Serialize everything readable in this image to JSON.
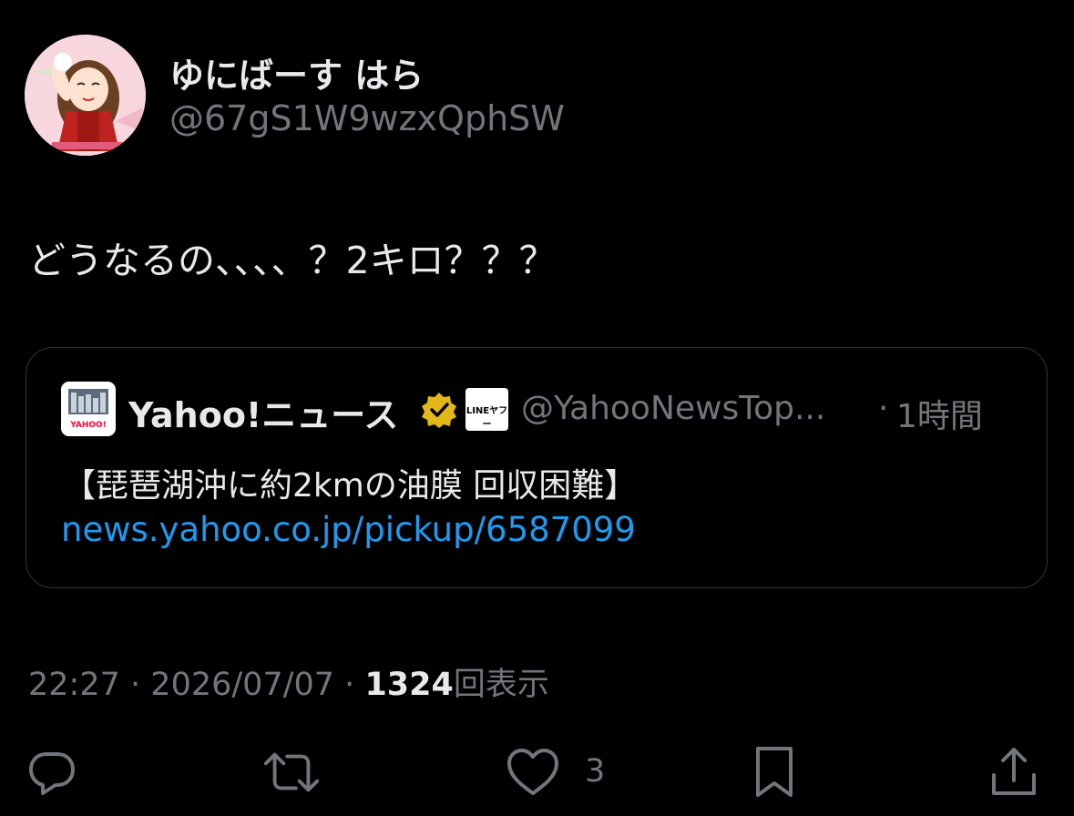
{
  "author": {
    "display_name": "ゆにばーす はら",
    "handle": "@67gS1W9wzxQphSW"
  },
  "tweet": {
    "text": "どうなるの、、、、？2キロ？？？"
  },
  "quote": {
    "name": "Yahoo!ニュース",
    "affiliate_label": "LINEヤフー",
    "avatar_label": "YAHOO!",
    "handle": "@YahooNewsTop...",
    "separator": "·",
    "time": "1時間",
    "text": "【琵琶湖沖に約2kmの油膜 回収困難】",
    "link": "news.yahoo.co.jp/pickup/6587099"
  },
  "meta": {
    "time": "22:27",
    "sep1": "·",
    "date": "2026/07/07",
    "sep2": "·",
    "views_count": "1324",
    "views_label": "回表示"
  },
  "actions": {
    "reply_icon": "reply-icon",
    "retweet_icon": "retweet-icon",
    "like_icon": "heart-icon",
    "like_count": "3",
    "bookmark_icon": "bookmark-icon",
    "share_icon": "share-icon"
  },
  "colors": {
    "background": "#000000",
    "primary_text": "#e7e9ea",
    "secondary_text": "#71767b",
    "link": "#1d9bf0",
    "border": "#2f3336",
    "verified_gold": "#e2b719"
  }
}
